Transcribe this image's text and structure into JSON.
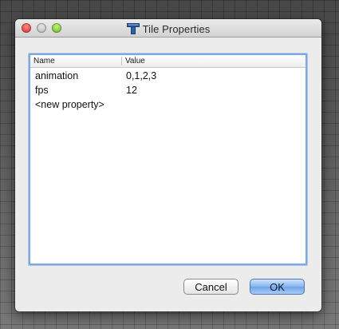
{
  "window": {
    "title": "Tile Properties"
  },
  "table": {
    "columns": {
      "name": "Name",
      "value": "Value"
    },
    "rows": [
      {
        "name": "animation",
        "value": "0,1,2,3"
      },
      {
        "name": "fps",
        "value": "12"
      },
      {
        "name": "<new property>",
        "value": ""
      }
    ]
  },
  "buttons": {
    "cancel": "Cancel",
    "ok": "OK"
  },
  "colors": {
    "accent": "#7fa8df",
    "close": "#e0443e",
    "maximize": "#7cc63a",
    "tiled_icon": "#2f5ea8"
  },
  "icons": {
    "title": "tiled-app-icon"
  }
}
